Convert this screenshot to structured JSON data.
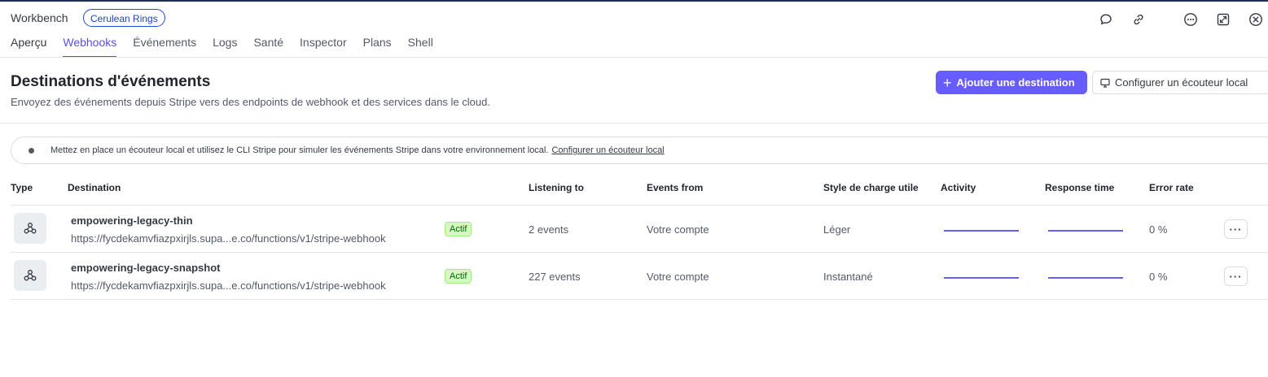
{
  "workbench": {
    "title": "Workbench",
    "account": "Cerulean Rings",
    "icons": [
      "chat-bubble-icon",
      "link-icon",
      "more-horizontal-icon",
      "collapse-icon",
      "close-icon"
    ]
  },
  "tabs": [
    "Aperçu",
    "Webhooks",
    "Événements",
    "Logs",
    "Santé",
    "Inspector",
    "Plans",
    "Shell"
  ],
  "active_tab": "Webhooks",
  "page": {
    "title": "Destinations d'événements",
    "subtitle": "Envoyez des événements depuis Stripe vers des endpoints de webhook et des services dans le cloud.",
    "add_button": "Ajouter une destination",
    "local_button": "Configurer un écouteur local"
  },
  "banner": {
    "text": "Mettez en place un écouteur local et utilisez le CLI Stripe pour simuler les événements Stripe dans votre environnement local.",
    "link": "Configurer un écouteur local"
  },
  "table": {
    "headers": {
      "type": "Type",
      "destination": "Destination",
      "listening": "Listening to",
      "events_from": "Events from",
      "style": "Style de charge utile",
      "activity": "Activity",
      "response": "Response time",
      "error": "Error rate"
    },
    "rows": [
      {
        "name": "empowering-legacy-thin",
        "url": "https://fycdekamvfiazpxirjls.supa...e.co/functions/v1/stripe-webhook",
        "status": "Actif",
        "listening": "2 events",
        "events_from": "Votre compte",
        "style": "Léger",
        "error_rate": "0 %"
      },
      {
        "name": "empowering-legacy-snapshot",
        "url": "https://fycdekamvfiazpxirjls.supa...e.co/functions/v1/stripe-webhook",
        "status": "Actif",
        "listening": "227 events",
        "events_from": "Votre compte",
        "style": "Instantané",
        "error_rate": "0 %"
      }
    ]
  },
  "colors": {
    "accent": "#675dff",
    "active_tab": "#5851df",
    "badge_bg": "#d7f7c2",
    "badge_text": "#006908"
  }
}
